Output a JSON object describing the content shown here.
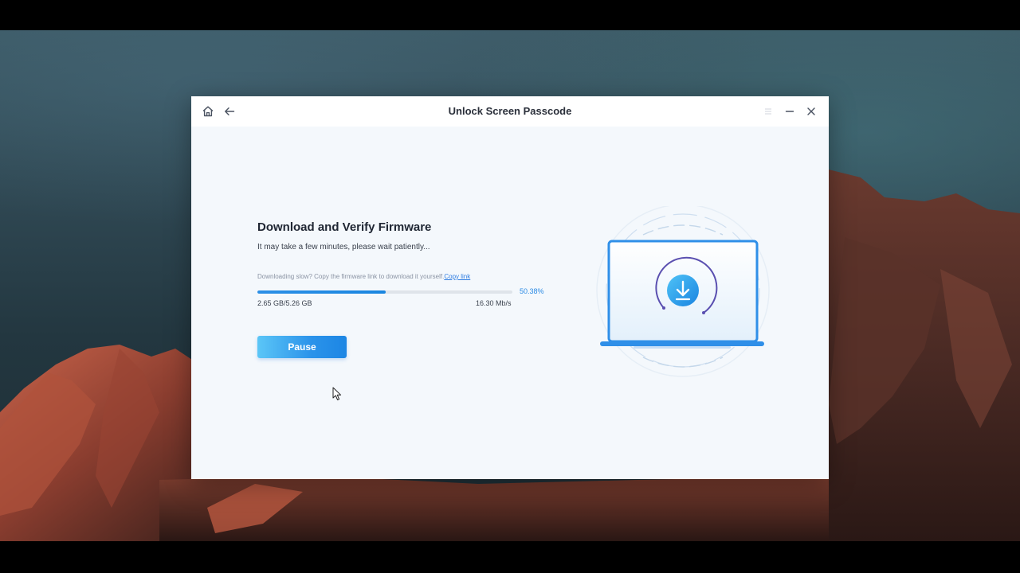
{
  "window": {
    "title": "Unlock Screen Passcode"
  },
  "toolbar_icons": {
    "home": "home-icon",
    "back": "arrow-left-icon",
    "menu": "menu-icon",
    "minimize": "minimize-icon",
    "close": "close-icon"
  },
  "content": {
    "heading": "Download and Verify Firmware",
    "subheading": "It may take a few minutes, please wait patiently...",
    "slow_text": "Downloading slow? Copy the firmware link to download it yourself.",
    "copy_link_label": "Copy link",
    "progress": {
      "percent": 50.38,
      "percent_label": "50.38%",
      "size_label": "2.65 GB/5.26 GB",
      "speed_label": "16.30 Mb/s"
    },
    "pause_label": "Pause"
  },
  "colors": {
    "accent": "#2a8ae4",
    "button_start": "#5bc6f7",
    "button_end": "#1c86e4",
    "window_bg": "#f4f8fc",
    "titlebar_bg": "#ffffff"
  },
  "illustration_icon": "laptop-download-icon"
}
